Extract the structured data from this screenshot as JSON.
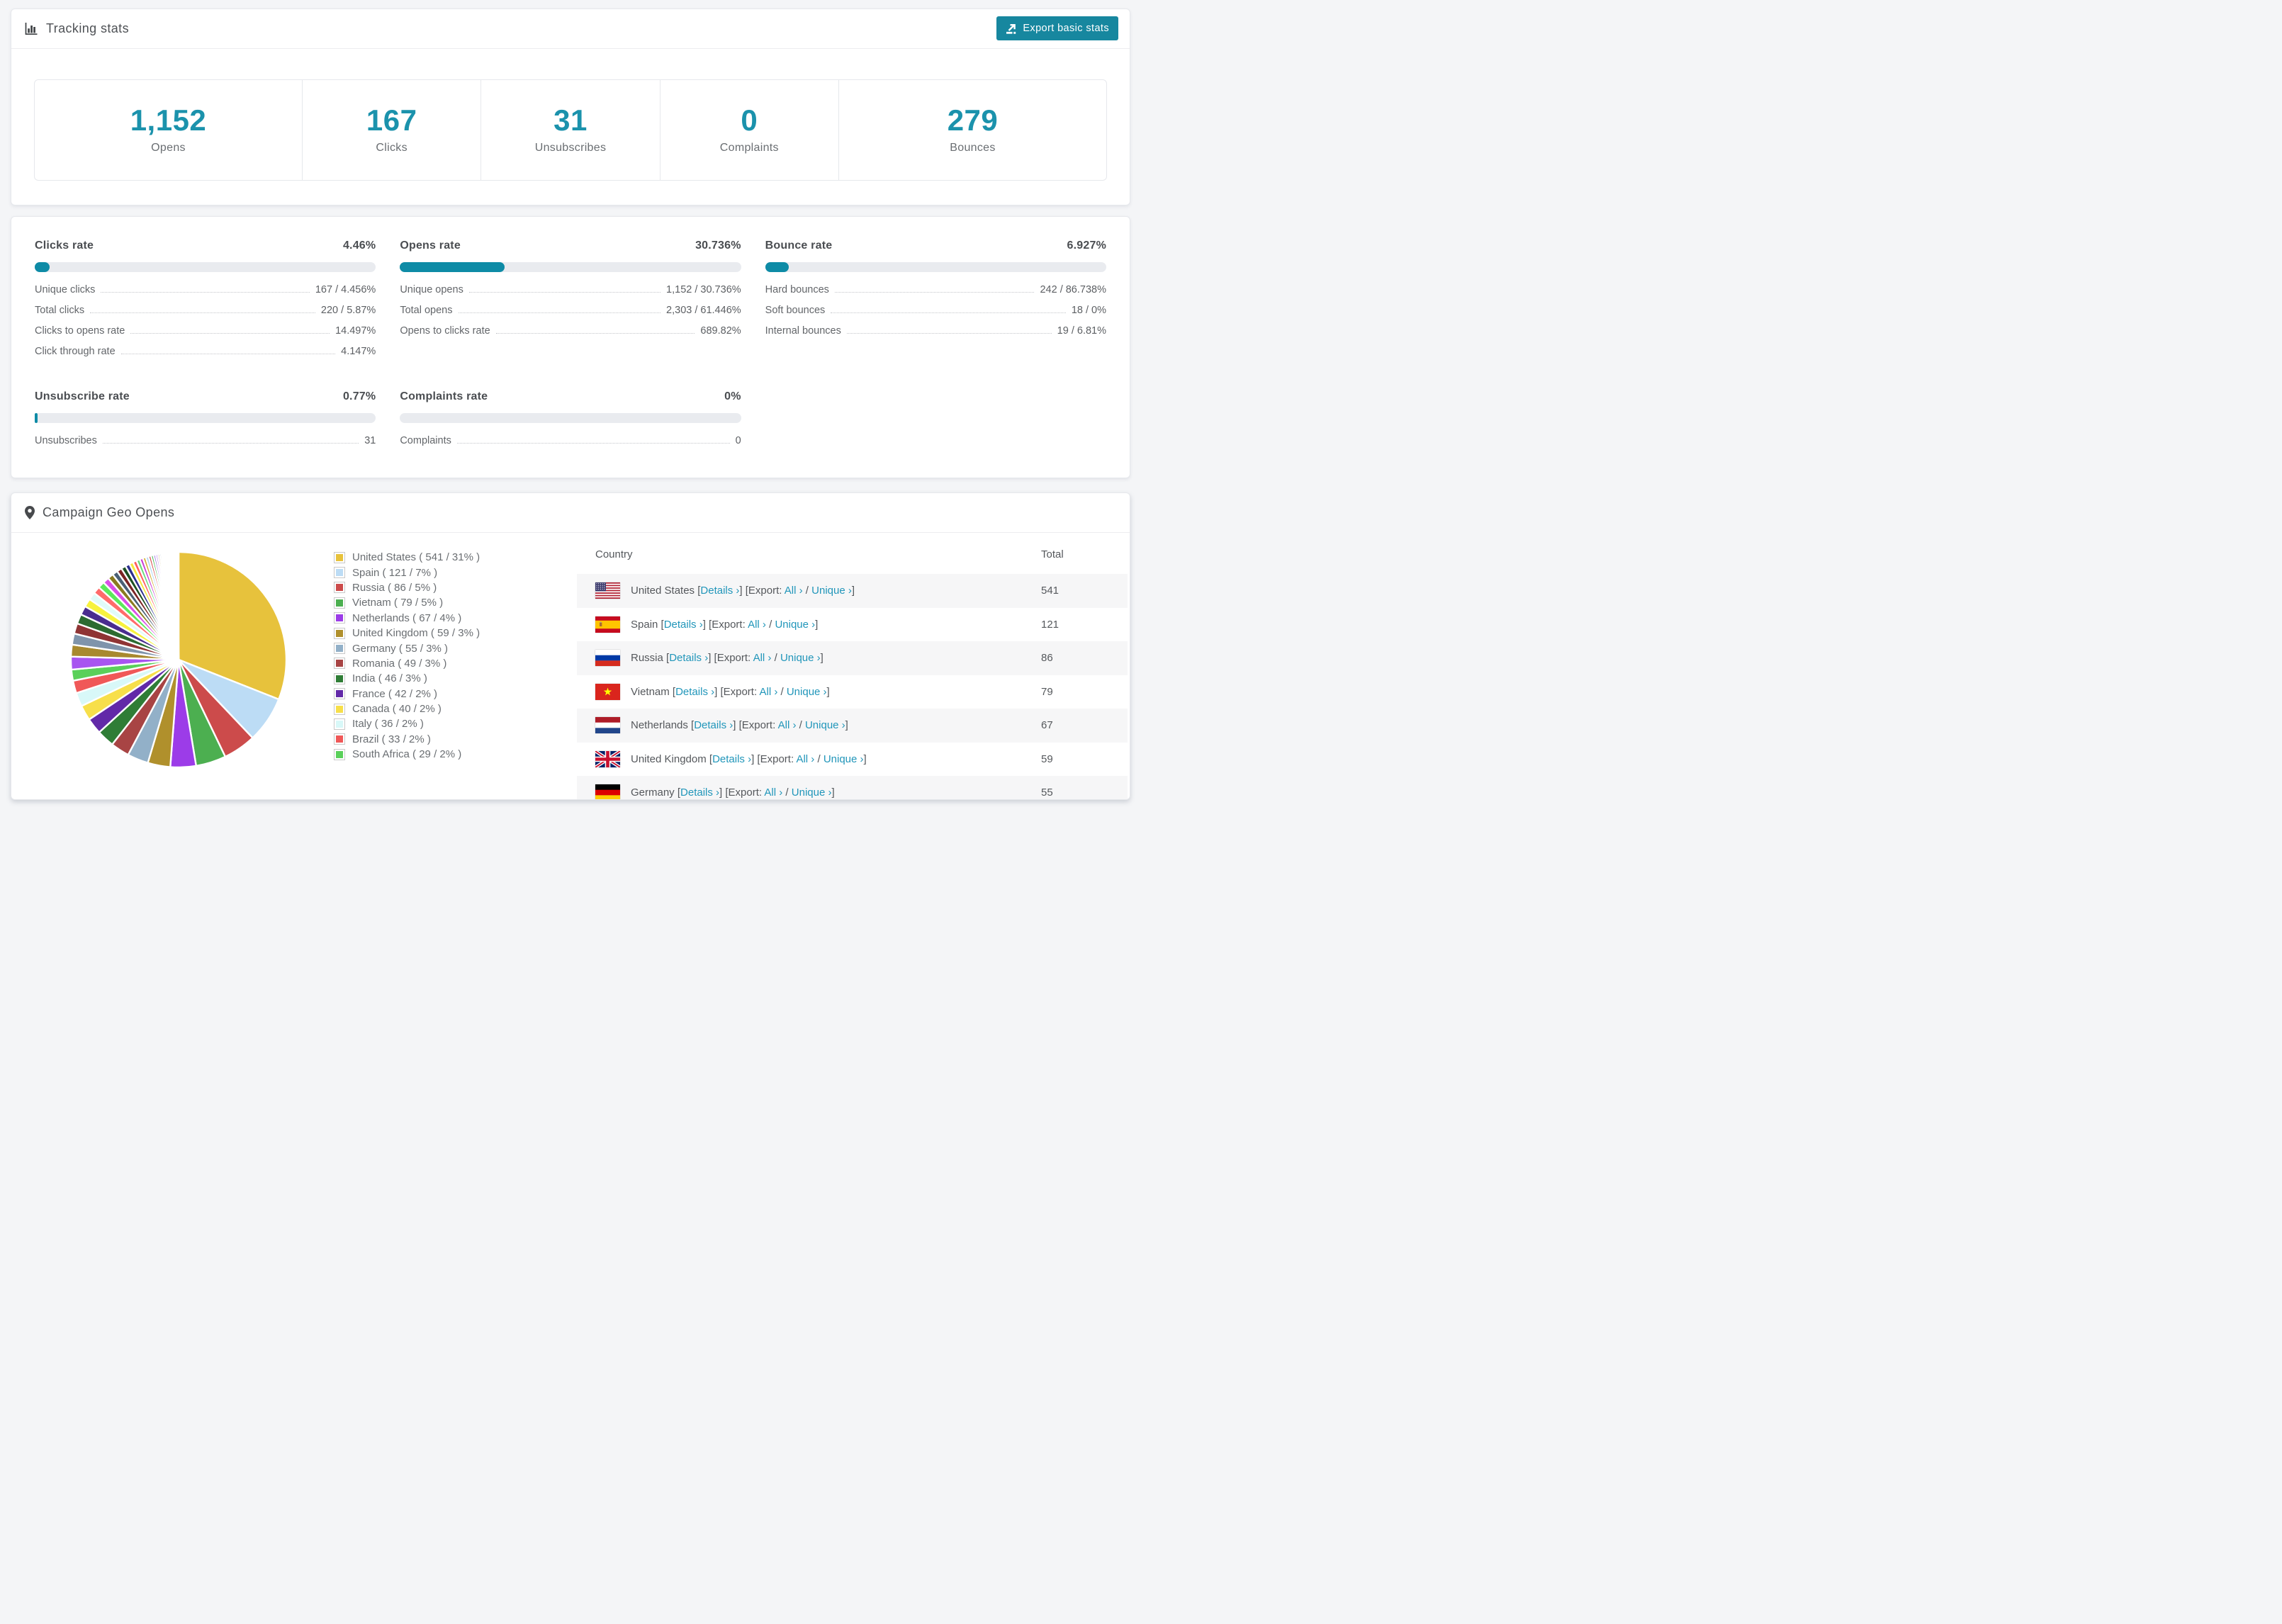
{
  "page": {
    "background": "#f4f5f7"
  },
  "colors": {
    "button_teal": "#17879f",
    "stat_number_teal": "#1b92ac",
    "progress_bar_teal": "#0e8ba6",
    "link_teal": "#2196ba",
    "progress_track_gray": "#e9ebef",
    "row_stripe_gray": "#f6f6f7"
  },
  "tracking": {
    "title": "Tracking stats",
    "export_button_label": "Export basic stats",
    "stats": [
      {
        "value": "1,152",
        "label": "Opens"
      },
      {
        "value": "167",
        "label": "Clicks"
      },
      {
        "value": "31",
        "label": "Unsubscribes"
      },
      {
        "value": "0",
        "label": "Complaints"
      },
      {
        "value": "279",
        "label": "Bounces"
      }
    ]
  },
  "rates": {
    "blocks": [
      {
        "title": "Clicks rate",
        "pct": "4.46%",
        "bar": 4.46,
        "rows": [
          [
            "Unique clicks",
            "167 / 4.456%"
          ],
          [
            "Total clicks",
            "220 / 5.87%"
          ],
          [
            "Clicks to opens rate",
            "14.497%"
          ],
          [
            "Click through rate",
            "4.147%"
          ]
        ]
      },
      {
        "title": "Opens rate",
        "pct": "30.736%",
        "bar": 30.736,
        "rows": [
          [
            "Unique opens",
            "1,152 / 30.736%"
          ],
          [
            "Total opens",
            "2,303 / 61.446%"
          ],
          [
            "Opens to clicks rate",
            "689.82%"
          ]
        ]
      },
      {
        "title": "Bounce rate",
        "pct": "6.927%",
        "bar": 6.927,
        "rows": [
          [
            "Hard bounces",
            "242 / 86.738%"
          ],
          [
            "Soft bounces",
            "18 / 0%"
          ],
          [
            "Internal bounces",
            "19 / 6.81%"
          ]
        ]
      },
      {
        "title": "Unsubscribe rate",
        "pct": "0.77%",
        "bar": 0.77,
        "rows": [
          [
            "Unsubscribes",
            "31"
          ]
        ]
      },
      {
        "title": "Complaints rate",
        "pct": "0%",
        "bar": 0,
        "rows": [
          [
            "Complaints",
            "0"
          ]
        ]
      }
    ]
  },
  "geo": {
    "title": "Campaign Geo Opens",
    "table": {
      "headers": {
        "country": "Country",
        "total": "Total"
      },
      "links": {
        "details": "Details",
        "export_prefix": "Export:",
        "all": "All",
        "unique": "Unique",
        "chevron": "›"
      },
      "rows": [
        {
          "flag": "us",
          "name": "United States",
          "total": "541"
        },
        {
          "flag": "es",
          "name": "Spain",
          "total": "121"
        },
        {
          "flag": "ru",
          "name": "Russia",
          "total": "86"
        },
        {
          "flag": "vn",
          "name": "Vietnam",
          "total": "79"
        },
        {
          "flag": "nl",
          "name": "Netherlands",
          "total": "67"
        },
        {
          "flag": "gb",
          "name": "United Kingdom",
          "total": "59"
        },
        {
          "flag": "de",
          "name": "Germany",
          "total": "55"
        }
      ]
    }
  },
  "chart_data": {
    "type": "pie",
    "title": "Campaign Geo Opens",
    "unit": "opens per country",
    "labels": [
      "United States",
      "Spain",
      "Russia",
      "Vietnam",
      "Netherlands",
      "United Kingdom",
      "Germany",
      "Romania",
      "India",
      "France",
      "Canada",
      "Italy",
      "Brazil",
      "South Africa"
    ],
    "values": [
      541,
      121,
      86,
      79,
      67,
      59,
      55,
      49,
      46,
      42,
      40,
      36,
      33,
      29
    ],
    "percent_labels": [
      "31%",
      "7%",
      "5%",
      "5%",
      "4%",
      "3%",
      "3%",
      "3%",
      "3%",
      "2%",
      "2%",
      "2%",
      "2%",
      "2%"
    ],
    "colors": [
      "#e7c23c",
      "#bcdcf5",
      "#cc4b4b",
      "#4caf50",
      "#9c3ce8",
      "#b0902c",
      "#92b0c8",
      "#a84444",
      "#2f7d36",
      "#6229a8",
      "#f7df4a",
      "#d8f8f8",
      "#f05858",
      "#5ad05a"
    ],
    "others_unlabeled_total": 462,
    "legend_position": "right of pie",
    "start_angle_deg": -90,
    "clockwise": true,
    "grid": false
  }
}
